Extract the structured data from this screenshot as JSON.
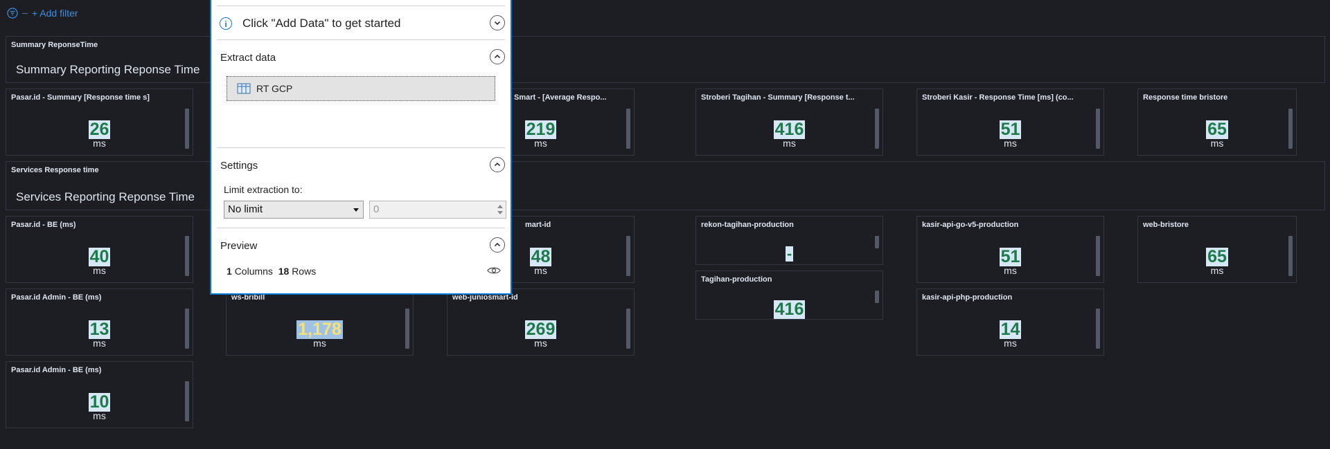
{
  "filterbar": {
    "add_filter": "+ Add filter"
  },
  "panels": {
    "summary_title": "Summary ReponseTime",
    "summary_text": "Summary Reporting Reponse Time",
    "services_title": "Services Response time",
    "services_text": "Services Reporting Reponse Time"
  },
  "metrics": [
    {
      "title": "Pasar.id - Summary [Response time s]",
      "value": "26",
      "unit": "ms"
    },
    {
      "title": "Smart - [Average Respo...",
      "value": "219",
      "unit": "ms"
    },
    {
      "title": "Stroberi Tagihan - Summary [Response t...",
      "value": "416",
      "unit": "ms"
    },
    {
      "title": "Stroberi Kasir - Response Time [ms] (co...",
      "value": "51",
      "unit": "ms"
    },
    {
      "title": "Response time bristore",
      "value": "65",
      "unit": "ms"
    },
    {
      "title": "Pasar.id - BE (ms)",
      "value": "40",
      "unit": "ms"
    },
    {
      "title": "mart-id",
      "value": "48",
      "unit": "ms"
    },
    {
      "title": "rekon-tagihan-production",
      "value": "-",
      "unit": ""
    },
    {
      "title": "kasir-api-go-v5-production",
      "value": "51",
      "unit": "ms"
    },
    {
      "title": "web-bristore",
      "value": "65",
      "unit": "ms"
    },
    {
      "title": "Tagihan-production",
      "value": "416",
      "unit": ""
    },
    {
      "title": "Pasar.id Admin - BE (ms)",
      "value": "13",
      "unit": "ms"
    },
    {
      "title": "ws-bribill",
      "value": "1,178",
      "unit": "ms"
    },
    {
      "title": "web-juniosmart-id",
      "value": "269",
      "unit": "ms"
    },
    {
      "title": "kasir-api-php-production",
      "value": "14",
      "unit": "ms"
    },
    {
      "title": "Pasar.id Admin - BE (ms)",
      "value": "10",
      "unit": "ms"
    }
  ],
  "dialog": {
    "header": "Click \"Add Data\" to get started",
    "extract_title": "Extract data",
    "source_label": "RT GCP",
    "settings_title": "Settings",
    "limit_label": "Limit extraction to:",
    "limit_value": "No limit",
    "limit_number": "0",
    "preview_title": "Preview",
    "columns_count": "1",
    "columns_label": "Columns",
    "rows_count": "18",
    "rows_label": "Rows"
  },
  "colors": {
    "background": "#1d1e24",
    "panel_border": "#343741",
    "metric_value": "#1e7a4a",
    "metric_highlight": "#d6e8f5",
    "warning_value": "#f5e27a",
    "link": "#3d8fe0",
    "dialog_border": "#0078d7"
  },
  "icons": [
    "filter-icon",
    "info-icon",
    "chevron-down-icon",
    "chevron-up-icon",
    "table-icon",
    "eye-icon"
  ]
}
